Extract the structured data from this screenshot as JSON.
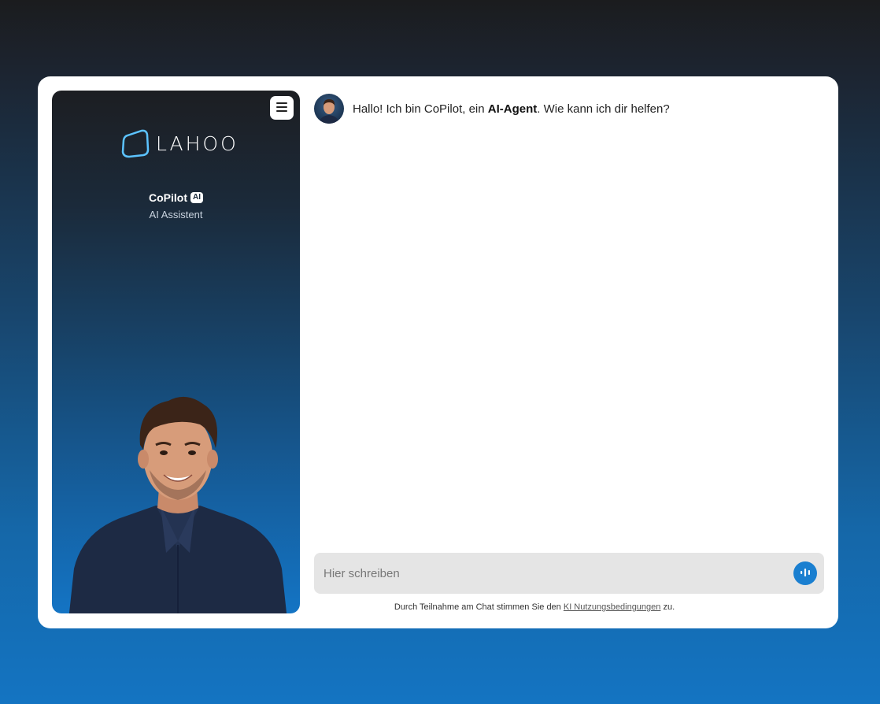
{
  "sidebar": {
    "logo_text": "LAHOO",
    "agent_name": "CoPilot",
    "agent_badge": "AI",
    "agent_role": "AI Assistent",
    "menu_icon": "hamburger-menu-icon"
  },
  "chat": {
    "greeting_prefix": "Hallo! Ich bin CoPilot, ein ",
    "greeting_bold": "AI-Agent",
    "greeting_suffix": ". Wie kann ich dir helfen?"
  },
  "input": {
    "placeholder": "Hier schreiben",
    "voice_icon": "voice-wave-icon"
  },
  "disclaimer": {
    "prefix": "Durch Teilnahme am Chat stimmen Sie den ",
    "link_text": "KI Nutzungsbedingungen",
    "suffix": " zu."
  },
  "colors": {
    "accent": "#1a7fd0",
    "sidebar_top": "#1c1e22",
    "sidebar_bottom": "#1474c4",
    "input_bg": "#e5e5e5"
  }
}
